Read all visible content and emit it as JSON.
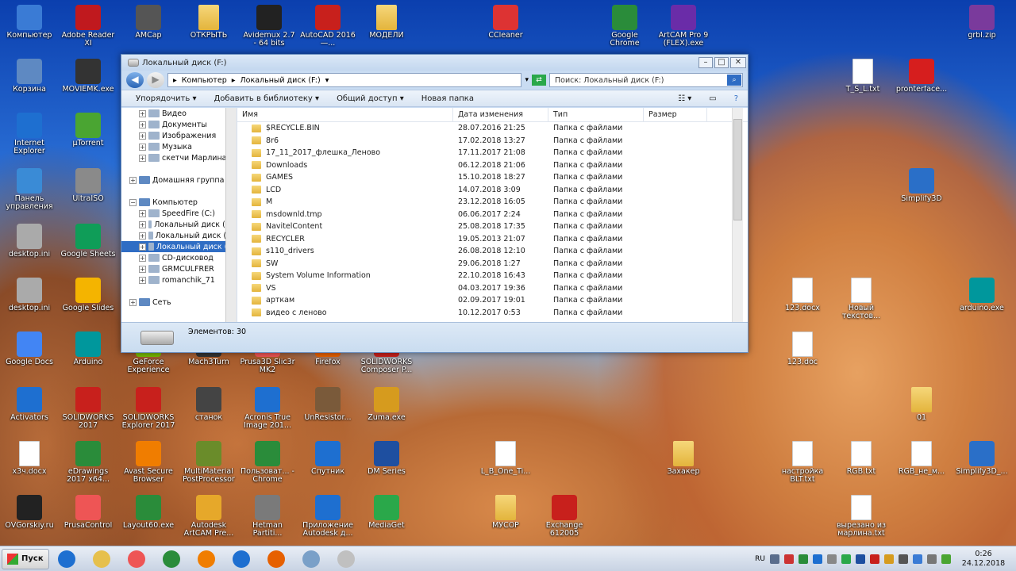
{
  "desktop_icons": [
    {
      "id": "computer",
      "label": "Компьютер",
      "color": "#3a7bd5"
    },
    {
      "id": "adobe",
      "label": "Adobe Reader XI",
      "color": "#c0191e"
    },
    {
      "id": "amcap",
      "label": "AMCap",
      "color": "#555555"
    },
    {
      "id": "otkryt",
      "label": "ОТКРЫТЬ",
      "color": "#e6c04c"
    },
    {
      "id": "avidemux",
      "label": "Avidemux 2.7 - 64 bits",
      "color": "#222222"
    },
    {
      "id": "autocad",
      "label": "AutoCAD 2016 —...",
      "color": "#c8201c"
    },
    {
      "id": "modeli",
      "label": "МОДЕЛИ",
      "color": "#e6c04c"
    },
    {
      "id": "ccleaner",
      "label": "CCleaner",
      "color": "#d33"
    },
    {
      "id": "chrome",
      "label": "Google Chrome",
      "color": "#2a8c3a"
    },
    {
      "id": "artcam",
      "label": "ArtCAM Pro 9 (FLEX).exe",
      "color": "#6a2ca8"
    },
    {
      "id": "grbl",
      "label": "grbl.zip",
      "color": "#7a3a9c"
    },
    {
      "id": "korzina",
      "label": "Корзина",
      "color": "#5e89c2"
    },
    {
      "id": "moviemk",
      "label": "MOVIEMK.exe",
      "color": "#333333"
    },
    {
      "id": "tsl",
      "label": "T_S_L.txt",
      "color": "#ffffff"
    },
    {
      "id": "pronterface",
      "label": "pronterface...",
      "color": "#d61e1e"
    },
    {
      "id": "ie",
      "label": "Internet Explorer",
      "color": "#1e6fd0"
    },
    {
      "id": "utorrent",
      "label": "µTorrent",
      "color": "#4aa532"
    },
    {
      "id": "panel",
      "label": "Панель управления",
      "color": "#3a8bd6"
    },
    {
      "id": "ultraiso",
      "label": "UltraISO",
      "color": "#8a8a8a"
    },
    {
      "id": "simplify",
      "label": "Simplify3D",
      "color": "#2a6fc8"
    },
    {
      "id": "desktopini1",
      "label": "desktop.ini",
      "color": "#aaaaaa"
    },
    {
      "id": "gsheets",
      "label": "Google Sheets",
      "color": "#0f9d58"
    },
    {
      "id": "desktopini2",
      "label": "desktop.ini",
      "color": "#aaaaaa"
    },
    {
      "id": "gslides",
      "label": "Google Slides",
      "color": "#f4b400"
    },
    {
      "id": "docx123",
      "label": "123.docx",
      "color": "#ffffff"
    },
    {
      "id": "noviy",
      "label": "Новый текстов...",
      "color": "#ffffff"
    },
    {
      "id": "arduinoexe",
      "label": "arduino.exe",
      "color": "#00979c"
    },
    {
      "id": "gdocs",
      "label": "Google Docs",
      "color": "#4285f4"
    },
    {
      "id": "arduino",
      "label": "Arduino",
      "color": "#00979c"
    },
    {
      "id": "geforce",
      "label": "GeForce Experience",
      "color": "#76b900"
    },
    {
      "id": "mach3",
      "label": "Mach3Turn",
      "color": "#333"
    },
    {
      "id": "prusa",
      "label": "Prusa3D Slic3r MK2",
      "color": "#e55"
    },
    {
      "id": "firefox",
      "label": "Firefox",
      "color": "#e66000"
    },
    {
      "id": "swcomposer",
      "label": "SOLIDWORKS Composer P...",
      "color": "#c8201c"
    },
    {
      "id": "doc123",
      "label": "123.doc",
      "color": "#ffffff"
    },
    {
      "id": "activators",
      "label": "Activators",
      "color": "#1e6fd0"
    },
    {
      "id": "sw2017",
      "label": "SOLIDWORKS 2017",
      "color": "#c8201c"
    },
    {
      "id": "swexplorer",
      "label": "SOLIDWORKS Explorer 2017",
      "color": "#c8201c"
    },
    {
      "id": "stanok",
      "label": "станок",
      "color": "#444"
    },
    {
      "id": "acronis",
      "label": "Acronis True Image 201...",
      "color": "#1e6fd0"
    },
    {
      "id": "unresistor",
      "label": "UnResistor...",
      "color": "#7a5a3a"
    },
    {
      "id": "zuma",
      "label": "Zuma.exe",
      "color": "#d69b1e"
    },
    {
      "id": "f01",
      "label": "01",
      "color": "#e6c04c"
    },
    {
      "id": "x3ch",
      "label": "х3ч.docx",
      "color": "#ffffff"
    },
    {
      "id": "edrawings",
      "label": "eDrawings 2017 x64...",
      "color": "#2a8c3a"
    },
    {
      "id": "avast",
      "label": "Avast Secure Browser",
      "color": "#f07d00"
    },
    {
      "id": "multimat",
      "label": "MultiMaterial PostProcessor",
      "color": "#6a8c2a"
    },
    {
      "id": "polz",
      "label": "Пользоват... - Chrome",
      "color": "#2a8c3a"
    },
    {
      "id": "sputnik",
      "label": "Спутник",
      "color": "#1e6fd0"
    },
    {
      "id": "dm",
      "label": "DM Series",
      "color": "#1e4fa0"
    },
    {
      "id": "mp3",
      "label": "L_B_One_Ti...",
      "color": "#ffffff"
    },
    {
      "id": "zakhaker",
      "label": "Захакер",
      "color": "#e6c04c"
    },
    {
      "id": "nastroika",
      "label": "настройка BLT.txt",
      "color": "#ffffff"
    },
    {
      "id": "rgb",
      "label": "RGB.txt",
      "color": "#ffffff"
    },
    {
      "id": "rgbne",
      "label": "RGB_не_м...",
      "color": "#ffffff"
    },
    {
      "id": "simplify2",
      "label": "Simplify3D_...",
      "color": "#2a6fc8"
    },
    {
      "id": "ovgorskiy",
      "label": "OVGorskiy.ru",
      "color": "#222"
    },
    {
      "id": "prusacontrol",
      "label": "PrusaControl",
      "color": "#e55"
    },
    {
      "id": "layout",
      "label": "Layout60.exe",
      "color": "#2a8c3a"
    },
    {
      "id": "autodeskartcam",
      "label": "Autodesk ArtCAM Pre...",
      "color": "#e6a82a"
    },
    {
      "id": "hetman",
      "label": "Hetman Partiti...",
      "color": "#7a7a7a"
    },
    {
      "id": "prilozhenie",
      "label": "Приложение Autodesk д...",
      "color": "#1e6fd0"
    },
    {
      "id": "mediaget",
      "label": "MediaGet",
      "color": "#2aa84a"
    },
    {
      "id": "musor",
      "label": "МУСОР",
      "color": "#e6c04c"
    },
    {
      "id": "exchange",
      "label": "Exchange 612005",
      "color": "#c8201c"
    },
    {
      "id": "vyrezano",
      "label": "вырезано из марлина.txt",
      "color": "#ffffff"
    }
  ],
  "window": {
    "title": "Локальный диск (F:)",
    "address": [
      "Компьютер",
      "Локальный диск (F:)"
    ],
    "search_placeholder": "Поиск: Локальный диск (F:)",
    "toolbar": {
      "organize": "Упорядочить",
      "library": "Добавить в библиотеку",
      "share": "Общий доступ",
      "new_folder": "Новая папка"
    },
    "nav": [
      {
        "label": "Видео",
        "indent": 1,
        "exp": "+"
      },
      {
        "label": "Документы",
        "indent": 1,
        "exp": "+"
      },
      {
        "label": "Изображения",
        "indent": 1,
        "exp": "+"
      },
      {
        "label": "Музыка",
        "indent": 1,
        "exp": "+"
      },
      {
        "label": "скетчи Марлина",
        "indent": 1,
        "exp": "+"
      },
      {
        "label": "",
        "indent": 0,
        "exp": ""
      },
      {
        "label": "Домашняя группа",
        "indent": 0,
        "exp": "+"
      },
      {
        "label": "",
        "indent": 0,
        "exp": ""
      },
      {
        "label": "Компьютер",
        "indent": 0,
        "exp": "−"
      },
      {
        "label": "SpeedFire (C:)",
        "indent": 1,
        "exp": "+"
      },
      {
        "label": "Локальный диск (D:)",
        "indent": 1,
        "exp": "+"
      },
      {
        "label": "Локальный диск (E:)",
        "indent": 1,
        "exp": "+"
      },
      {
        "label": "Локальный диск (F:)",
        "indent": 1,
        "exp": "+",
        "selected": true
      },
      {
        "label": "CD-дисковод",
        "indent": 1,
        "exp": "+"
      },
      {
        "label": "GRMCULFRER",
        "indent": 1,
        "exp": "+"
      },
      {
        "label": "romanchik_71",
        "indent": 1,
        "exp": "+"
      },
      {
        "label": "",
        "indent": 0,
        "exp": ""
      },
      {
        "label": "Сеть",
        "indent": 0,
        "exp": "+"
      }
    ],
    "columns": [
      "Имя",
      "Дата изменения",
      "Тип",
      "Размер"
    ],
    "files": [
      {
        "name": "$RECYCLE.BIN",
        "date": "28.07.2016 21:25",
        "type": "Папка с файлами"
      },
      {
        "name": "8r6",
        "date": "17.02.2018 13:27",
        "type": "Папка с файлами"
      },
      {
        "name": "17_11_2017_флешка_Леново",
        "date": "17.11.2017 21:08",
        "type": "Папка с файлами"
      },
      {
        "name": "Downloads",
        "date": "06.12.2018 21:06",
        "type": "Папка с файлами"
      },
      {
        "name": "GAMES",
        "date": "15.10.2018 18:27",
        "type": "Папка с файлами"
      },
      {
        "name": "LCD",
        "date": "14.07.2018 3:09",
        "type": "Папка с файлами"
      },
      {
        "name": "M",
        "date": "23.12.2018 16:05",
        "type": "Папка с файлами"
      },
      {
        "name": "msdownld.tmp",
        "date": "06.06.2017 2:24",
        "type": "Папка с файлами"
      },
      {
        "name": "NavitelContent",
        "date": "25.08.2018 17:35",
        "type": "Папка с файлами"
      },
      {
        "name": "RECYCLER",
        "date": "19.05.2013 21:07",
        "type": "Папка с файлами"
      },
      {
        "name": "s110_drivers",
        "date": "26.08.2018 12:10",
        "type": "Папка с файлами"
      },
      {
        "name": "SW",
        "date": "29.06.2018 1:27",
        "type": "Папка с файлами"
      },
      {
        "name": "System Volume Information",
        "date": "22.10.2018 16:43",
        "type": "Папка с файлами"
      },
      {
        "name": "VS",
        "date": "04.03.2017 19:36",
        "type": "Папка с файлами"
      },
      {
        "name": "арткам",
        "date": "02.09.2017 19:01",
        "type": "Папка с файлами"
      },
      {
        "name": "видео с леново",
        "date": "10.12.2017 0:53",
        "type": "Папка с файлами"
      }
    ],
    "status": "Элементов: 30"
  },
  "taskbar": {
    "start": "Пуск",
    "lang": "RU",
    "time": "0:26",
    "date": "24.12.2018",
    "apps": [
      "#1e6fd0",
      "#e6c04c",
      "#e55",
      "#2a8c3a",
      "#f07d00",
      "#1e6fd0",
      "#e66000",
      "#7aa0c8",
      "#c0c0c0"
    ]
  }
}
